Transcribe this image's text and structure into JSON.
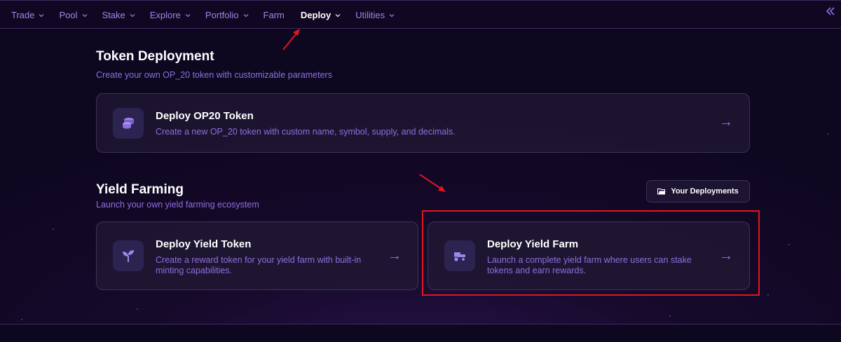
{
  "nav": {
    "items": [
      {
        "label": "Trade",
        "dropdown": true
      },
      {
        "label": "Pool",
        "dropdown": true
      },
      {
        "label": "Stake",
        "dropdown": true
      },
      {
        "label": "Explore",
        "dropdown": true
      },
      {
        "label": "Portfolio",
        "dropdown": true
      },
      {
        "label": "Farm",
        "dropdown": false
      },
      {
        "label": "Deploy",
        "dropdown": true,
        "active": true
      },
      {
        "label": "Utilities",
        "dropdown": true
      }
    ]
  },
  "token_deployment": {
    "title": "Token Deployment",
    "subtitle": "Create your own OP_20 token with customizable parameters",
    "card": {
      "title": "Deploy OP20 Token",
      "description": "Create a new OP_20 token with custom name, symbol, supply, and decimals.",
      "icon": "coins-icon"
    }
  },
  "yield_farming": {
    "title": "Yield Farming",
    "subtitle": "Launch your own yield farming ecosystem",
    "deployments_button": "Your Deployments",
    "cards": [
      {
        "title": "Deploy Yield Token",
        "description": "Create a reward token for your yield farm with built-in minting capabilities.",
        "icon": "sprout-icon"
      },
      {
        "title": "Deploy Yield Farm",
        "description": "Launch a complete yield farm where users can stake tokens and earn rewards.",
        "icon": "tractor-icon"
      }
    ]
  },
  "colors": {
    "accent": "#8e6fe0",
    "annotation": "#e0161f",
    "background": "#170a2c"
  }
}
